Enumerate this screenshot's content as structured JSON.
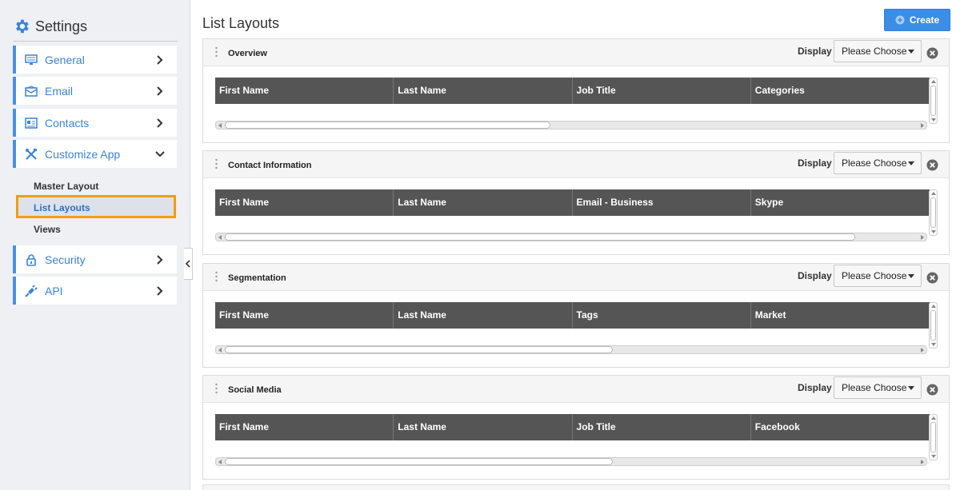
{
  "sidebar": {
    "title": "Settings",
    "items": [
      {
        "label": "General"
      },
      {
        "label": "Email"
      },
      {
        "label": "Contacts"
      },
      {
        "label": "Customize App"
      },
      {
        "label": "Security"
      },
      {
        "label": "API"
      }
    ],
    "sub_items": [
      {
        "label": "Master Layout"
      },
      {
        "label": "List Layouts"
      },
      {
        "label": "Views"
      }
    ]
  },
  "main": {
    "title": "List Layouts",
    "create_label": "Create",
    "panels": [
      {
        "title": "Overview",
        "display_label": "Display",
        "select_value": "Please Choose",
        "columns": [
          "First Name",
          "Last Name",
          "Job Title",
          "Categories"
        ],
        "scroll_fraction": 0.47
      },
      {
        "title": "Contact Information",
        "display_label": "Display",
        "select_value": "Please Choose",
        "columns": [
          "First Name",
          "Last Name",
          "Email - Business",
          "Skype"
        ],
        "scroll_fraction": 0.91
      },
      {
        "title": "Segmentation",
        "display_label": "Display",
        "select_value": "Please Choose",
        "columns": [
          "First Name",
          "Last Name",
          "Tags",
          "Market"
        ],
        "scroll_fraction": 0.56
      },
      {
        "title": "Social Media",
        "display_label": "Display",
        "select_value": "Please Choose",
        "columns": [
          "First Name",
          "Last Name",
          "Job Title",
          "Facebook"
        ],
        "scroll_fraction": 0.56
      }
    ]
  },
  "colors": {
    "accent": "#3a8ee8",
    "highlight_border": "#f39c12",
    "grid_header": "#555555"
  }
}
